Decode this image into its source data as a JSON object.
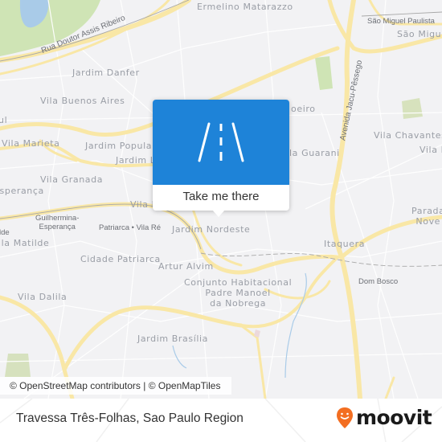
{
  "map": {
    "colors": {
      "land": "#f2f2f4",
      "major_road": "#f9e7a6",
      "minor_road": "#ffffff",
      "park": "#cfe4b5",
      "water": "#a9cbe8",
      "rail": "#a8a8a8",
      "label": "#9a9ea6"
    },
    "neighborhood_labels": [
      {
        "text": "Ermelino\nMatarazzo"
      },
      {
        "text": "Jardim Danfer"
      },
      {
        "text": "Vila Buenos\nAires"
      },
      {
        "text": "Vila Marieta"
      },
      {
        "text": "Jardim Popular"
      },
      {
        "text": "Jardim L"
      },
      {
        "text": "Vila Granada"
      },
      {
        "text": "Esperança"
      },
      {
        "text": "Vila R"
      },
      {
        "text": "ila Matilde"
      },
      {
        "text": "Cidade Patriarca"
      },
      {
        "text": "Artur Alvim"
      },
      {
        "text": "Jardim Nordeste"
      },
      {
        "text": "Conjunto Habitacional\nPadre Manoel\nda Nobrega"
      },
      {
        "text": "Vila Dalila"
      },
      {
        "text": "Jardim Brasília"
      },
      {
        "text": "oeiro"
      },
      {
        "text": "la Guarani"
      },
      {
        "text": "Vila Chavantes"
      },
      {
        "text": "Vila F"
      },
      {
        "text": "Parada\nNove"
      },
      {
        "text": "Itaquera"
      },
      {
        "text": "São Migue"
      },
      {
        "text": "ul"
      }
    ],
    "station_labels": [
      {
        "text": "São Miguel Paulista"
      },
      {
        "text": "Guilhermina-\nEsperança"
      },
      {
        "text": "Patriarca • Vila Ré"
      },
      {
        "text": "Dom Bosco"
      },
      {
        "text": "lde"
      }
    ],
    "street_labels": [
      {
        "text": "Rua Doutor Assis Ribeiro"
      },
      {
        "text": "Avenida Jacu-Pêssego"
      }
    ]
  },
  "popup": {
    "icon": "road-icon",
    "action_label": "Take me there",
    "accent_color": "#1e83d8"
  },
  "attribution": {
    "text": "© OpenStreetMap contributors | © OpenMapTiles"
  },
  "footer": {
    "location_title": "Travessa Três-Folhas, Sao Paulo Region",
    "brand_name": "moovit",
    "brand_color": "#f36e21"
  }
}
